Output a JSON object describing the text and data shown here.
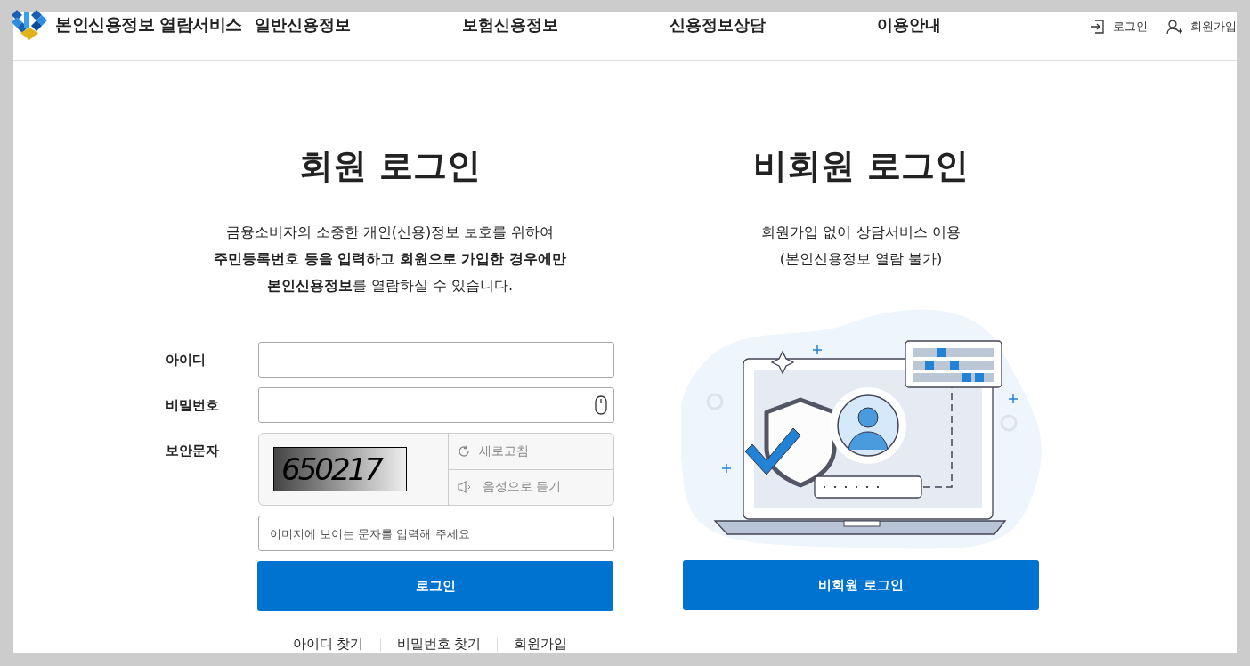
{
  "header": {
    "logo_text": "본인신용정보 열람서비스",
    "nav": [
      {
        "label": "일반신용정보",
        "selected": false
      },
      {
        "label": "보험신용정보",
        "selected": false
      },
      {
        "label": "신용정보상담",
        "selected": false
      },
      {
        "label": "이용안내",
        "selected": false
      }
    ],
    "utility_links": [
      {
        "kind": "login",
        "label": "로그인"
      },
      {
        "kind": "join",
        "label": "회원가입"
      }
    ]
  },
  "member_login": {
    "title": "회원 로그인",
    "description": "금융소비자의 소중한 개인(신용)정보 보호를 위하여\n**주민등록번호 등을 입력하고 회원으로 가입한 경우에만**\n**본인신용정보**를 열람하실 수 있습니다.",
    "fields": [
      {
        "kind": "text",
        "label": "아이디"
      },
      {
        "kind": "password",
        "label": "비밀번호"
      },
      {
        "kind": "captcha",
        "label": "보안문자",
        "captcha_text": "650217",
        "placeholder": "이미지에 보이는 문자를 입력해 주세요",
        "actions": [
          {
            "kind": "refresh",
            "label": "새로고침"
          },
          {
            "kind": "audio",
            "label": "음성으로 듣기"
          }
        ]
      }
    ],
    "button": "로그인",
    "links": [
      "아이디 찾기",
      "비밀번호 찾기",
      "회원가입"
    ]
  },
  "guest_login": {
    "title": "비회원 로그인",
    "description": "회원가입 없이 상담서비스 이용\n(본인신용정보 열람 불가)",
    "button": "비회원 로그인"
  }
}
